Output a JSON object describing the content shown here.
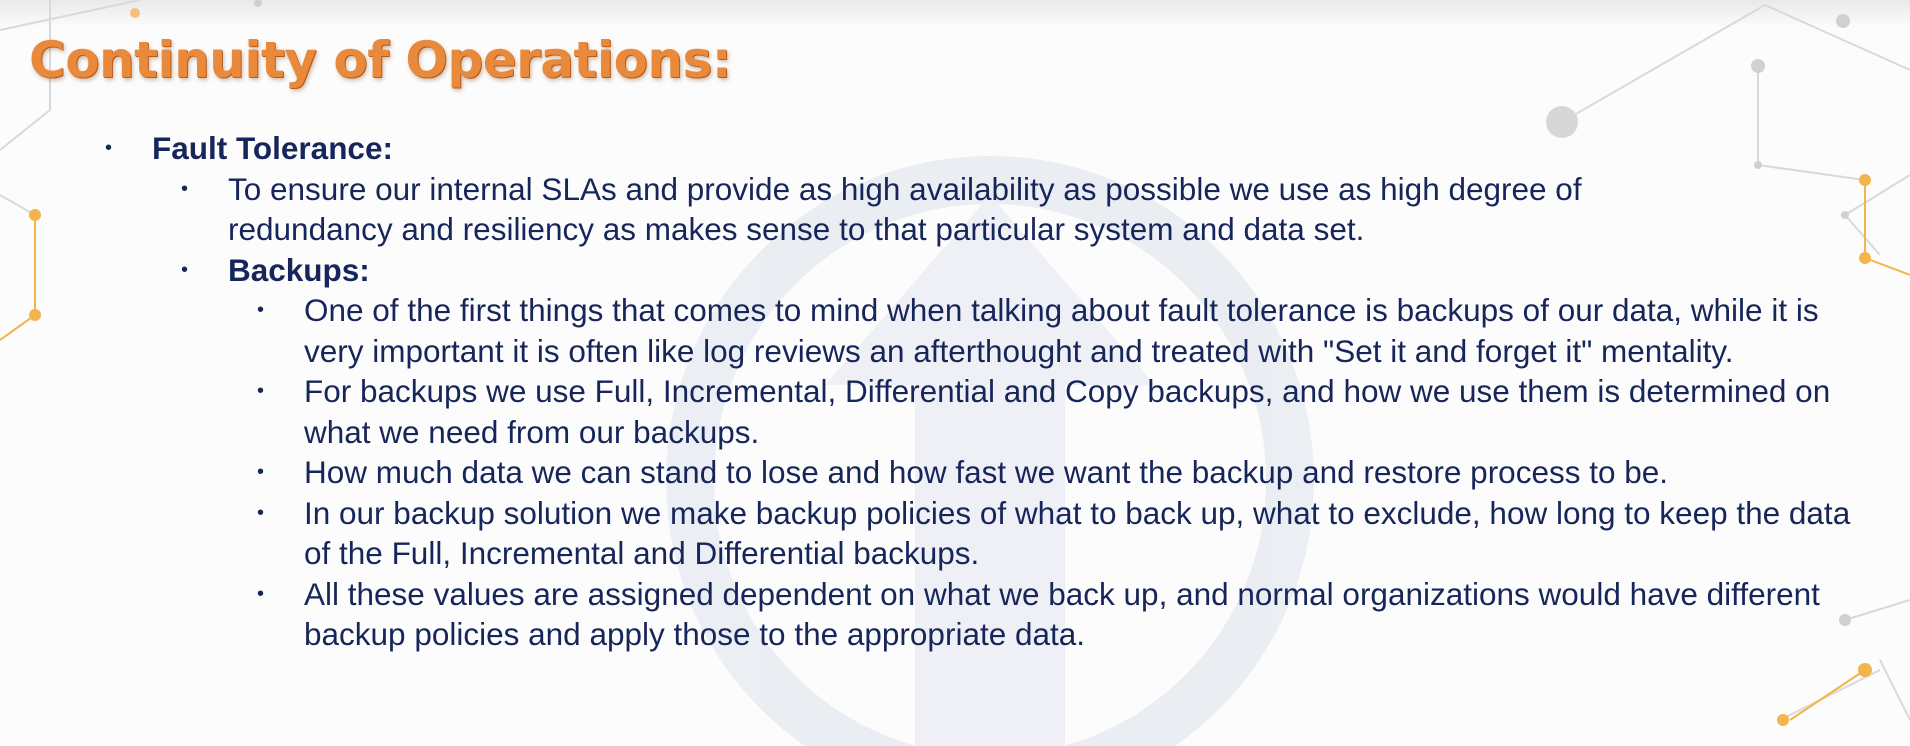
{
  "slide": {
    "title": "Continuity of Operations:",
    "bullet_symbol": "•",
    "colors": {
      "title": "#e8893c",
      "text": "#17265a",
      "accent_decor": "#f2b44c",
      "watermark": "#dde3ec"
    },
    "fault_tolerance": {
      "heading": "Fault Tolerance:",
      "intro": "To ensure our internal SLAs and provide as high availability as possible we use as high degree of redundancy and resiliency as makes sense to that particular system and data set.",
      "backups": {
        "heading": "Backups:",
        "points": [
          "One of the first things that comes to mind when talking about fault tolerance is backups of our data, while it is very important it is often like log reviews an afterthought and treated with \"Set it and forget it\" mentality.",
          "For backups we use Full, Incremental, Differential and Copy backups, and how we use them is determined on what we need from our backups.",
          "How much data we can stand to lose and how fast we want the backup and restore process to be.",
          "In our backup solution we make backup policies of what to back up, what to exclude, how long to keep the data of the Full, Incremental and Differential backups.",
          "All these values are assigned dependent on what we back up, and normal organizations would have different backup policies and apply those to the appropriate data."
        ]
      }
    }
  }
}
